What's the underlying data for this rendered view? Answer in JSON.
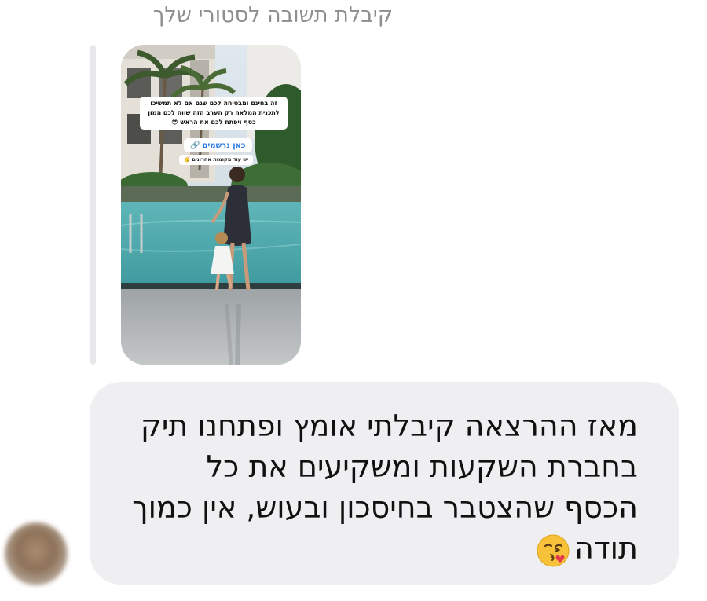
{
  "header": {
    "reply_caption": "קיבלת תשובה לסטורי שלך"
  },
  "story": {
    "caption": "זה בחינם ומבטיחה לכם שגם אם לא תמשיכו לתכנית המלאה רק הערב הזה שווה לכם המון כסף ויפתח לכם את הראש 😎",
    "link_label": "כאן נרשמים",
    "link_icon": "link-icon",
    "tag_label": "יש עוד מקומות אחרונים 🥳"
  },
  "message": {
    "lines": [
      "מאז ההרצאה קיבלתי אומץ ופתחנו תיק",
      "בחברת השקעות ומשקיעים את כל",
      "הכסף שהצטבר בחיסכון ובעוש, אין כמוך",
      "תודה"
    ],
    "emoji": "😘"
  },
  "colors": {
    "bubble_bg": "#efeff1",
    "caption_gray": "#8e8e8e",
    "link_blue": "#2c7be5"
  }
}
